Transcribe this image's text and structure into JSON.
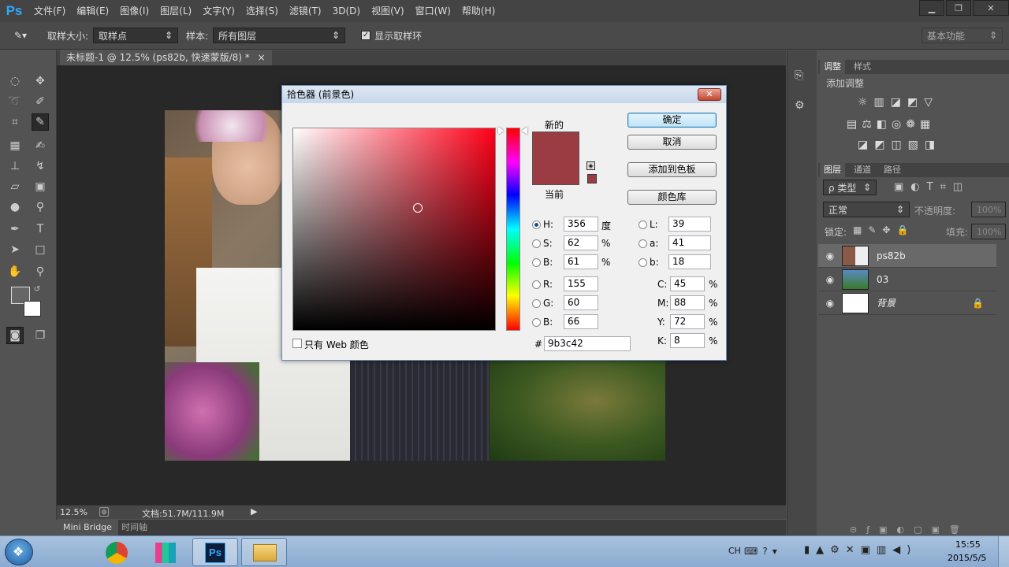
{
  "app": {
    "logo": "Ps"
  },
  "menu": [
    "文件(F)",
    "编辑(E)",
    "图像(I)",
    "图层(L)",
    "文字(Y)",
    "选择(S)",
    "滤镜(T)",
    "3D(D)",
    "视图(V)",
    "窗口(W)",
    "帮助(H)"
  ],
  "window_controls": {
    "minimize": "▁",
    "restore": "❐",
    "close": "✕"
  },
  "options_bar": {
    "sample_size_label": "取样大小:",
    "sample_size_value": "取样点",
    "sample_label": "样本:",
    "sample_value": "所有图层",
    "show_ring_label": "显示取样环",
    "workspace": "基本功能"
  },
  "document_tab": {
    "title": "未标题-1 @ 12.5% (ps82b, 快速蒙版/8) *",
    "close": "×"
  },
  "status_bar": {
    "zoom": "12.5%",
    "doc_size": "文档:51.7M/111.9M"
  },
  "bottom_tabs": [
    "Mini Bridge",
    "时间轴"
  ],
  "adjustments_panel": {
    "tabs": [
      "调整",
      "样式"
    ],
    "heading": "添加调整"
  },
  "layers_panel": {
    "tabs": [
      "图层",
      "通道",
      "路径"
    ],
    "filter_label": "ρ 类型",
    "blend_mode": "正常",
    "opacity_label": "不透明度:",
    "opacity_value": "100%",
    "lock_label": "锁定:",
    "fill_label": "填充:",
    "fill_value": "100%",
    "layers": [
      {
        "name": "ps82b"
      },
      {
        "name": "03"
      },
      {
        "name": "背景"
      }
    ]
  },
  "color_picker": {
    "title": "拾色器 (前景色)",
    "close": "✕",
    "new_label": "新的",
    "current_label": "当前",
    "new_color": "#9b3c42",
    "current_color": "#9b3c42",
    "buttons": {
      "ok": "确定",
      "cancel": "取消",
      "add_swatch": "添加到色板",
      "libraries": "颜色库"
    },
    "web_only_label": "只有 Web 颜色",
    "fields": {
      "H": {
        "label": "H:",
        "value": "356",
        "unit": "度"
      },
      "S": {
        "label": "S:",
        "value": "62",
        "unit": "%"
      },
      "Bv": {
        "label": "B:",
        "value": "61",
        "unit": "%"
      },
      "R": {
        "label": "R:",
        "value": "155"
      },
      "G": {
        "label": "G:",
        "value": "60"
      },
      "Bc": {
        "label": "B:",
        "value": "66"
      },
      "L": {
        "label": "L:",
        "value": "39"
      },
      "a": {
        "label": "a:",
        "value": "41"
      },
      "b": {
        "label": "b:",
        "value": "18"
      },
      "C": {
        "label": "C:",
        "value": "45",
        "unit": "%"
      },
      "M": {
        "label": "M:",
        "value": "88",
        "unit": "%"
      },
      "Y": {
        "label": "Y:",
        "value": "72",
        "unit": "%"
      },
      "K": {
        "label": "K:",
        "value": "8",
        "unit": "%"
      }
    },
    "hex_label": "#",
    "hex_value": "9b3c42"
  },
  "taskbar": {
    "lang": "CH",
    "time": "15:55",
    "date": "2015/5/5"
  }
}
